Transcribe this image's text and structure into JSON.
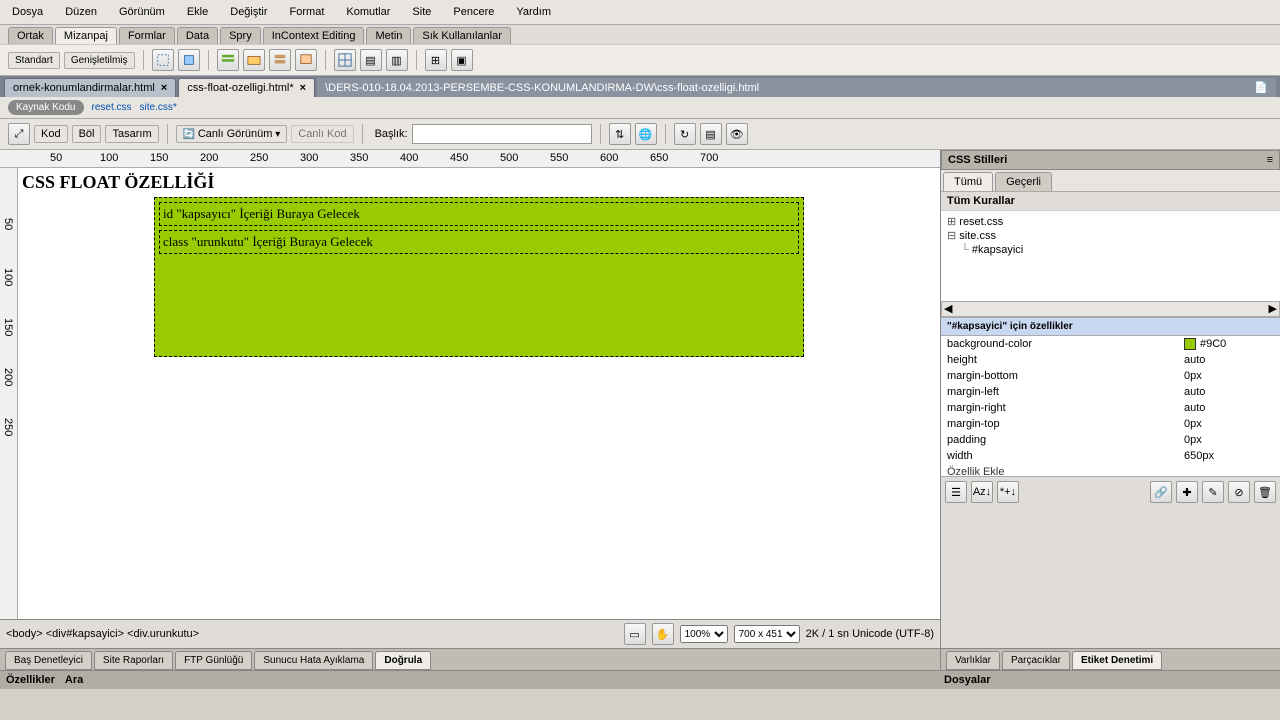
{
  "menu": [
    "Dosya",
    "Düzen",
    "Görünüm",
    "Ekle",
    "Değiştir",
    "Format",
    "Komutlar",
    "Site",
    "Pencere",
    "Yardım"
  ],
  "insert_tabs": [
    "Ortak",
    "Mizanpaj",
    "Formlar",
    "Data",
    "Spry",
    "InContext Editing",
    "Metin",
    "Sık Kullanılanlar"
  ],
  "insert_active": 1,
  "layout_buttons": [
    "Standart",
    "Genişletilmiş"
  ],
  "doc_tabs": [
    {
      "label": "ornek-konumlandirmalar.html",
      "active": false
    },
    {
      "label": "css-float-ozelligi.html*",
      "active": true
    }
  ],
  "doc_path": "\\DERS-010-18.04.2013-PERSEMBE-CSS-KONUMLANDIRMA-DW\\css-float-ozelligi.html",
  "related": {
    "pill": "Kaynak Kodu",
    "files": [
      "reset.css",
      "site.css*"
    ]
  },
  "view_buttons": {
    "kod": "Kod",
    "bol": "Böl",
    "tasarim": "Tasarım",
    "canli": "Canlı Görünüm",
    "canlikod": "Canlı Kod",
    "baslik_label": "Başlık:",
    "baslik_value": ""
  },
  "canvas": {
    "heading": "CSS FLOAT ÖZELLİĞİ",
    "row1": "id \"kapsayıcı\" İçeriği Buraya Gelecek",
    "row2": "class \"urunkutu\" İçeriği Buraya Gelecek"
  },
  "css_panel": {
    "title": "CSS Stilleri",
    "tabs": [
      "Tümü",
      "Geçerli"
    ],
    "tabs_active": 0,
    "rules_title": "Tüm Kurallar",
    "tree": [
      "reset.css",
      "site.css",
      "#kapsayici"
    ],
    "props_title": "\"#kapsayici\" için özellikler",
    "props": [
      {
        "k": "background-color",
        "v": "#9C0",
        "swatch": true
      },
      {
        "k": "height",
        "v": "auto"
      },
      {
        "k": "margin-bottom",
        "v": "0px"
      },
      {
        "k": "margin-left",
        "v": "auto"
      },
      {
        "k": "margin-right",
        "v": "auto"
      },
      {
        "k": "margin-top",
        "v": "0px"
      },
      {
        "k": "padding",
        "v": "0px"
      },
      {
        "k": "width",
        "v": "650px"
      }
    ],
    "add_prop": "Özellik Ekle"
  },
  "status": {
    "breadcrumb": "<body> <div#kapsayici> <div.urunkutu>",
    "zoom": "100%",
    "size": "700 x 451",
    "info": "2K / 1 sn  Unicode (UTF-8)"
  },
  "bottom_tabs": [
    "Baş Denetleyici",
    "Site Raporları",
    "FTP Günlüğü",
    "Sunucu Hata Ayıklama",
    "Doğrula"
  ],
  "bottom_active": 4,
  "right_bottom_tabs": [
    "Varlıklar",
    "Parçacıklar",
    "Etiket Denetimi"
  ],
  "right_bottom_active": 2,
  "footer": [
    "Özellikler",
    "Ara"
  ],
  "footer_right": "Dosyalar",
  "chart_data": null
}
